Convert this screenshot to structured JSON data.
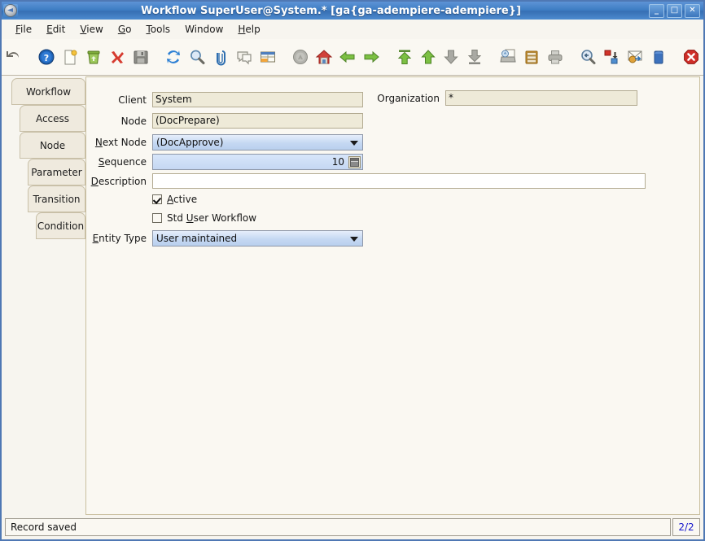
{
  "window": {
    "title": "Workflow  SuperUser@System.* [ga{ga-adempiere-adempiere}]",
    "app_icon": "adempiere-disc-icon",
    "buttons": {
      "minimize": "_",
      "maximize": "□",
      "close": "✕"
    },
    "titlebar_color": "#3f7ec4",
    "border_color": "#4f78b4"
  },
  "menubar": {
    "items": [
      {
        "label": "File",
        "mnemonic": "F"
      },
      {
        "label": "Edit",
        "mnemonic": "E"
      },
      {
        "label": "View",
        "mnemonic": "V"
      },
      {
        "label": "Go",
        "mnemonic": "G"
      },
      {
        "label": "Tools",
        "mnemonic": "T"
      },
      {
        "label": "Window",
        "mnemonic": ""
      },
      {
        "label": "Help",
        "mnemonic": "H"
      }
    ]
  },
  "toolbar": {
    "items": [
      {
        "name": "undo-icon",
        "tooltip": "Undo"
      },
      {
        "gap": true
      },
      {
        "name": "help-icon",
        "tooltip": "Help"
      },
      {
        "name": "new-record-icon",
        "tooltip": "New Record"
      },
      {
        "name": "delete-icon",
        "tooltip": "Delete"
      },
      {
        "name": "delete-selection-icon",
        "tooltip": "Delete Selection"
      },
      {
        "name": "save-icon",
        "tooltip": "Save"
      },
      {
        "gap": true
      },
      {
        "name": "refresh-icon",
        "tooltip": "Refresh"
      },
      {
        "name": "find-icon",
        "tooltip": "Find"
      },
      {
        "name": "attachment-icon",
        "tooltip": "Attachment"
      },
      {
        "name": "chat-icon",
        "tooltip": "Chat"
      },
      {
        "name": "grid-toggle-icon",
        "tooltip": "Toggle Grid"
      },
      {
        "gap": true
      },
      {
        "name": "history-icon",
        "tooltip": "History Records"
      },
      {
        "name": "home-icon",
        "tooltip": "Home"
      },
      {
        "name": "previous-record-icon",
        "tooltip": "Previous Record"
      },
      {
        "name": "next-record-icon",
        "tooltip": "Next Record"
      },
      {
        "gap": true
      },
      {
        "name": "first-record-icon",
        "tooltip": "First Record"
      },
      {
        "name": "parent-record-icon",
        "tooltip": "Parent Record"
      },
      {
        "name": "detail-record-icon",
        "tooltip": "Detail Record"
      },
      {
        "name": "last-record-icon",
        "tooltip": "Last Record"
      },
      {
        "gap": true
      },
      {
        "name": "report-icon",
        "tooltip": "Report"
      },
      {
        "name": "archive-icon",
        "tooltip": "Archived Documents"
      },
      {
        "name": "print-icon",
        "tooltip": "Print"
      },
      {
        "gap": true
      },
      {
        "name": "zoom-across-icon",
        "tooltip": "Zoom Across"
      },
      {
        "name": "active-workflow-icon",
        "tooltip": "Active Workflow"
      },
      {
        "name": "request-icon",
        "tooltip": "Requests"
      },
      {
        "name": "product-info-icon",
        "tooltip": "Product Info"
      },
      {
        "gap": true
      },
      {
        "name": "exit-icon",
        "tooltip": "Exit"
      }
    ]
  },
  "tabs": [
    {
      "label": "Workflow",
      "indent": 0,
      "selected": true
    },
    {
      "label": "Access",
      "indent": 10,
      "selected": false
    },
    {
      "label": "Node",
      "indent": 10,
      "selected": false
    },
    {
      "label": "Parameter",
      "indent": 20,
      "selected": false
    },
    {
      "label": "Transition",
      "indent": 20,
      "selected": false
    },
    {
      "label": "Condition",
      "indent": 30,
      "selected": false
    }
  ],
  "form": {
    "client": {
      "label": "Client",
      "value": "System",
      "readonly": true
    },
    "organization": {
      "label": "Organization",
      "value": "*",
      "readonly": true
    },
    "node": {
      "label": "Node",
      "value": "(DocPrepare)",
      "readonly": true
    },
    "next_node": {
      "label": "Next Node",
      "mnemonic": "N",
      "value": "(DocApprove)"
    },
    "sequence": {
      "label": "Sequence",
      "mnemonic": "S",
      "value": "10"
    },
    "description": {
      "label": "Description",
      "mnemonic": "D",
      "value": "",
      "placeholder": ""
    },
    "active": {
      "label": "Active",
      "mnemonic": "A",
      "checked": true
    },
    "std_user_workflow": {
      "label": "Std User Workflow",
      "mnemonic": "U",
      "checked": false
    },
    "entity_type": {
      "label": "Entity Type",
      "mnemonic": "E",
      "value": "User maintained"
    }
  },
  "statusbar": {
    "message": "Record saved",
    "record_count": "2/2",
    "count_color": "#1414cc"
  }
}
